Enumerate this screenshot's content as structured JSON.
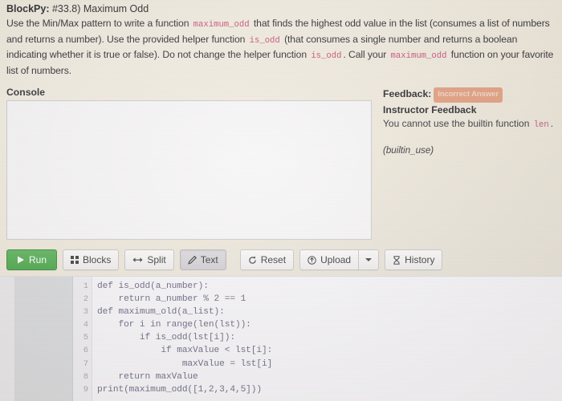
{
  "prompt": {
    "title_label": "BlockPy:",
    "title_text": " #33.8) Maximum Odd",
    "body_1": "Use the Min/Max pattern to write a function ",
    "code_1": "maximum_odd",
    "body_2": " that finds the highest odd value in the list (consumes a list of numbers and returns a number). Use the provided helper function ",
    "code_2": "is_odd",
    "body_3": " (that consumes a single number and returns a boolean indicating whether it is true or false). Do not change the helper function ",
    "code_3": "is_odd",
    "body_4": ". Call your ",
    "code_4": "maximum_odd",
    "body_5": " function on your favorite list of numbers."
  },
  "console": {
    "label": "Console",
    "content": ""
  },
  "feedback": {
    "heading_label": "Feedback:",
    "status_badge": "Incorrect Answer",
    "status_color": "#e3a183",
    "subheading": "Instructor Feedback",
    "message_1": "You cannot use the builtin function ",
    "message_code": "len",
    "message_2": ".",
    "tag": "(builtin_use)"
  },
  "toolbar": {
    "run_label": "Run",
    "blocks_label": "Blocks",
    "split_label": "Split",
    "text_label": "Text",
    "reset_label": "Reset",
    "upload_label": "Upload",
    "history_label": "History",
    "active_view": "Text",
    "icons": {
      "run": "play-icon",
      "blocks": "grid-icon",
      "split": "arrows-horizontal-icon",
      "text": "pencil-icon",
      "reset": "refresh-icon",
      "upload": "upload-circle-icon",
      "upload_caret": "chevron-down-icon",
      "history": "hourglass-icon"
    }
  },
  "editor": {
    "line_numbers": [
      "1",
      "2",
      "3",
      "4",
      "5",
      "6",
      "7",
      "8",
      "9"
    ],
    "code": "def is_odd(a_number):\n    return a_number % 2 == 1\ndef maximum_old(a_list):\n    for i in range(len(lst)):\n        if is_odd(lst[i]):\n            if maxValue < lst[i]:\n                maxValue = lst[i]\n    return maxValue\nprint(maximum_odd([1,2,3,4,5]))"
  }
}
